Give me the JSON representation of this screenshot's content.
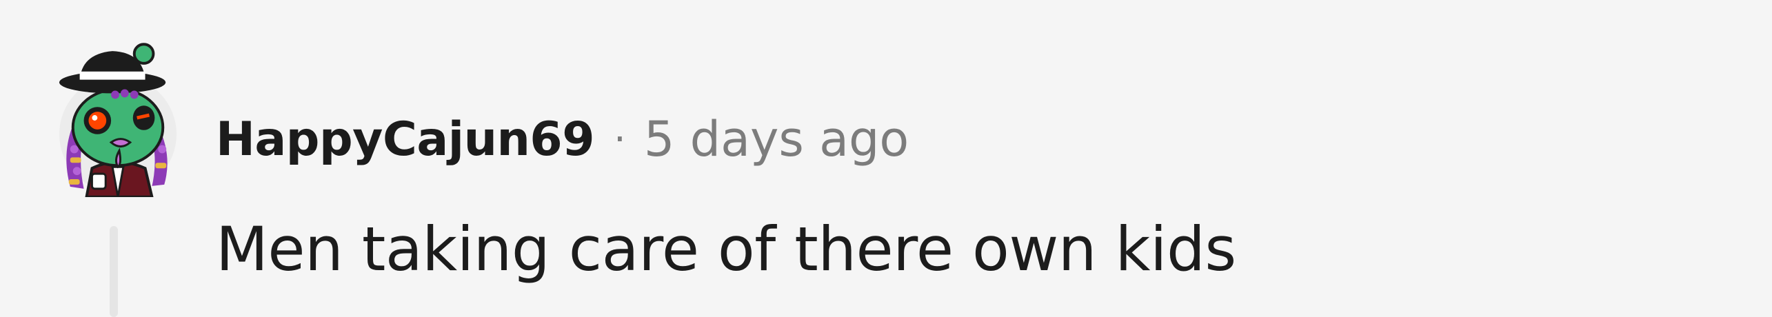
{
  "comment": {
    "author": "HappyCajun69",
    "separator": "·",
    "timestamp": "5 days ago",
    "body": "Men taking care of there own kids",
    "avatar_icon": "snoo-avatar-icon"
  },
  "colors": {
    "background": "#f5f5f5",
    "text_primary": "#1c1c1c",
    "text_secondary": "#7c7c7c",
    "thread_line": "#e5e5e5"
  }
}
